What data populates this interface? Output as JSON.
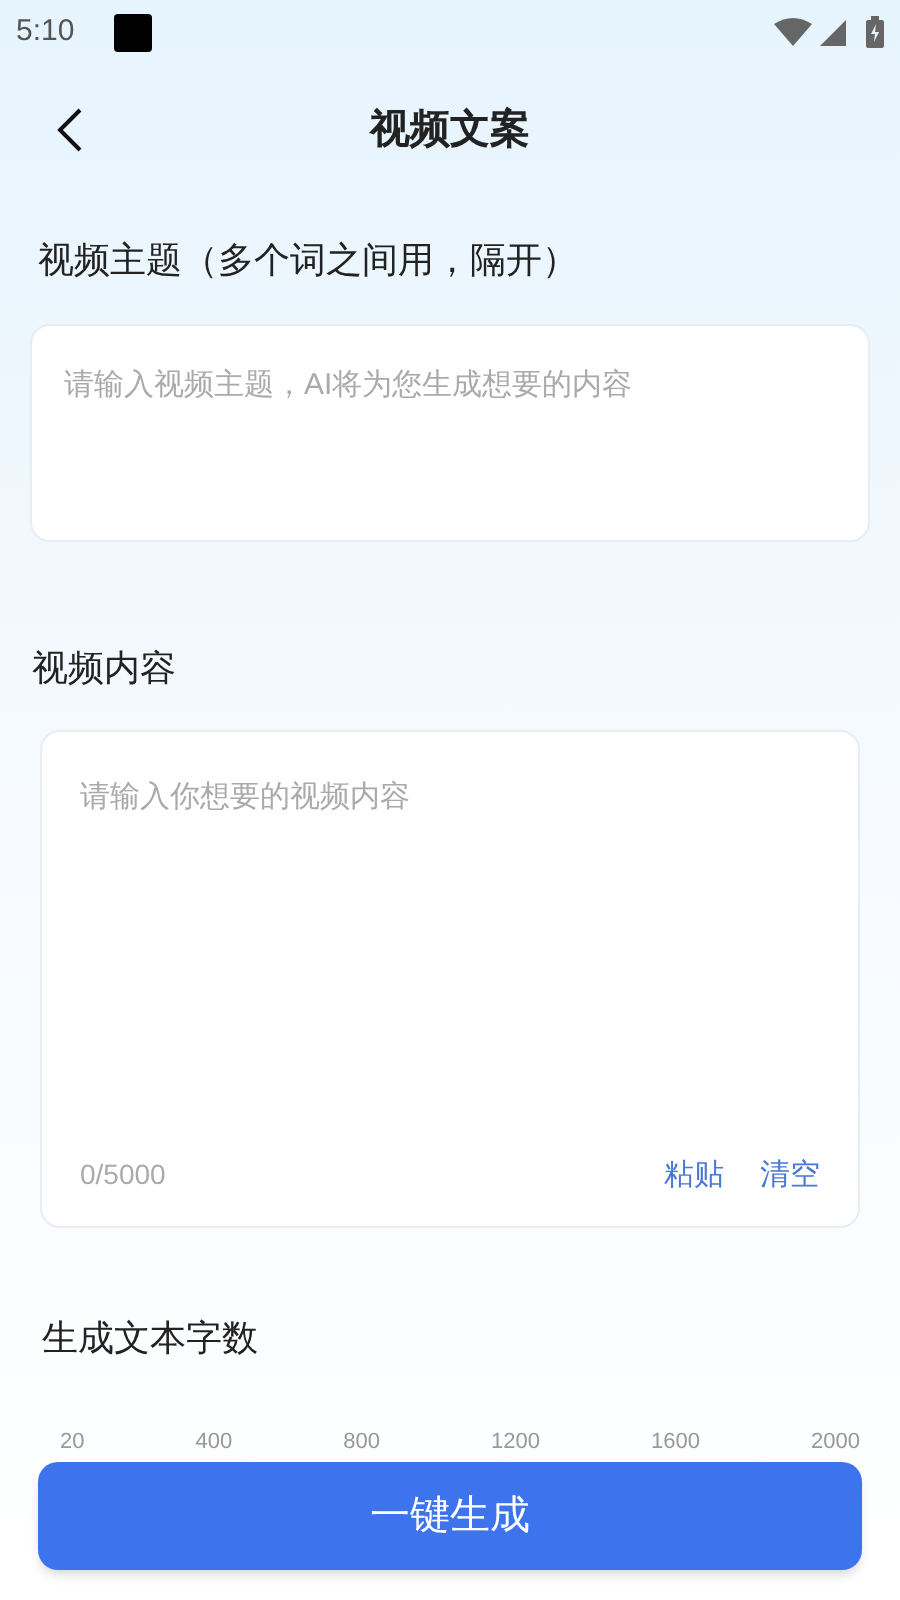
{
  "status_bar": {
    "time": "5:10"
  },
  "header": {
    "title": "视频文案"
  },
  "topic": {
    "label": "视频主题（多个词之间用，隔开）",
    "placeholder": "请输入视频主题，AI将为您生成想要的内容"
  },
  "content": {
    "label": "视频内容",
    "placeholder": "请输入你想要的视频内容",
    "counter": "0/5000",
    "actions": [
      "粘贴",
      "清空"
    ]
  },
  "length": {
    "label": "生成文本字数",
    "ticks": [
      "20",
      "400",
      "800",
      "1200",
      "1600",
      "2000"
    ]
  },
  "generate_button": {
    "label": "一键生成"
  }
}
